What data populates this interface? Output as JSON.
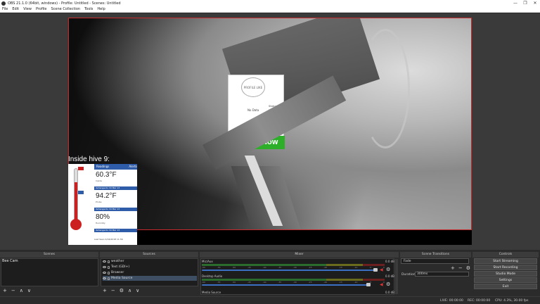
{
  "window": {
    "title": "OBS 21.1.0 (64bit, windows) - Profile: Untitled - Scenes: Untitled",
    "minimize": "—",
    "maximize": "❐",
    "close": "✕"
  },
  "menu": [
    "File",
    "Edit",
    "View",
    "Profile",
    "Scene Collection",
    "Tools",
    "Help"
  ],
  "preview": {
    "phone": {
      "circle_text": "PROFILE LIKE",
      "no_data": "No Data",
      "side_lines": [
        "Status",
        "Month"
      ],
      "button": "START NOW"
    },
    "hive": {
      "label": "Inside hive 9:",
      "header_left": "Readings",
      "header_right": "Alerts",
      "readings": [
        {
          "value": "60.3°F",
          "sub": "Inside"
        },
        {
          "value": "94.2°F",
          "sub": "Probe"
        },
        {
          "value": "80%",
          "sub": "Humidity"
        }
      ],
      "bars": [
        "dehangerdo 3d Mar 13",
        "dehangerdo 3d Mar 13",
        "dehangerdo 3d Mar 13"
      ],
      "footer": "Last Seen  4/16/2018 11:56"
    }
  },
  "docks": {
    "scenes": {
      "title": "Scenes",
      "items": [
        "Bee Cam"
      ]
    },
    "sources": {
      "title": "Sources",
      "items": [
        "weather",
        "Text (GDI+)",
        "Browser",
        "Media Source"
      ],
      "selected_index": 3
    },
    "mixer": {
      "title": "Mixer",
      "channels": [
        {
          "name": "Mic/Aux",
          "db": "0.0 dB",
          "volume": 1.0
        },
        {
          "name": "Desktop Audio",
          "db": "0.0 dB",
          "volume": 0.95
        },
        {
          "name": "Media Source",
          "db": "0.0 dB",
          "volume": 1.0
        }
      ],
      "ticks": [
        "-60",
        "-55",
        "-50",
        "-45",
        "-40",
        "-35",
        "-30",
        "-25",
        "-20",
        "-15",
        "-10",
        "-5",
        "0"
      ]
    },
    "transitions": {
      "title": "Scene Transitions",
      "selected": "Fade",
      "duration_label": "Duration",
      "duration_value": "300ms"
    },
    "controls": {
      "title": "Controls",
      "buttons": [
        "Start Streaming",
        "Start Recording",
        "Studio Mode",
        "Settings",
        "Exit"
      ]
    }
  },
  "tool_glyphs": {
    "add": "+",
    "remove": "−",
    "up": "∧",
    "down": "∨",
    "gear": "⚙"
  },
  "status": {
    "live": "LIVE: 00:00:00",
    "rec": "REC: 00:00:00",
    "cpu": "CPU: 4.3%, 30.00 fps"
  },
  "colors": {
    "accent_red": "#c62a2a",
    "selection": "#3e4e63",
    "volume_blue": "#3a6fc4",
    "start_button_green": "#2daf2a"
  }
}
